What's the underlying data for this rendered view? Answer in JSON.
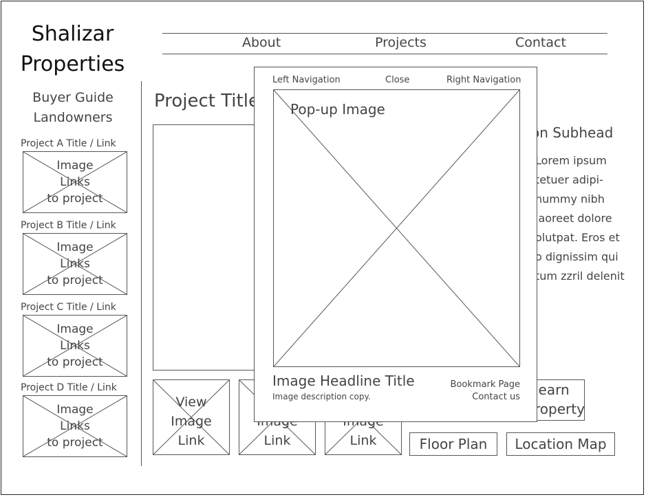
{
  "brand": {
    "line1": "Shalizar",
    "line2": "Properties"
  },
  "nav": {
    "about": "About",
    "projects": "Projects",
    "contact": "Contact"
  },
  "sidebar": {
    "links": [
      "Buyer Guide",
      "Landowners"
    ],
    "projects": [
      {
        "title": "Project A Title / Link",
        "image_lines": [
          "Image",
          "Links",
          "to project"
        ]
      },
      {
        "title": "Project B Title / Link",
        "image_lines": [
          "Image",
          "Links",
          "to project"
        ]
      },
      {
        "title": "Project C Title / Link",
        "image_lines": [
          "Image",
          "Links",
          "to project"
        ]
      },
      {
        "title": "Project D Title / Link",
        "image_lines": [
          "Image",
          "Links",
          "to project"
        ]
      }
    ]
  },
  "main": {
    "project_title": "Project Title",
    "subhead": "Subhead",
    "subhead_prefix": "on",
    "body_lines": [
      "Lorem ipsum",
      "tetuer adipi-",
      "nummy nibh",
      "laoreet dolore",
      "olutpat. Eros et",
      "o dignissim qui",
      "tum zzril delenit"
    ],
    "thumbs": [
      {
        "lines": [
          "View",
          "Image",
          "Link"
        ]
      },
      {
        "lines": [
          "Image",
          "Link"
        ]
      },
      {
        "lines": [
          "Image",
          "Link"
        ]
      }
    ],
    "learn_lines": [
      "learn",
      "roperty"
    ],
    "floor_plan": "Floor Plan",
    "location_map": "Location Map"
  },
  "popup": {
    "left_nav": "Left Navigation",
    "close": "Close",
    "right_nav": "Right Navigation",
    "image_label": "Pop-up Image",
    "headline": "Image Headline Title",
    "description": "Image description copy.",
    "bookmark": "Bookmark Page",
    "contact": "Contact us"
  }
}
